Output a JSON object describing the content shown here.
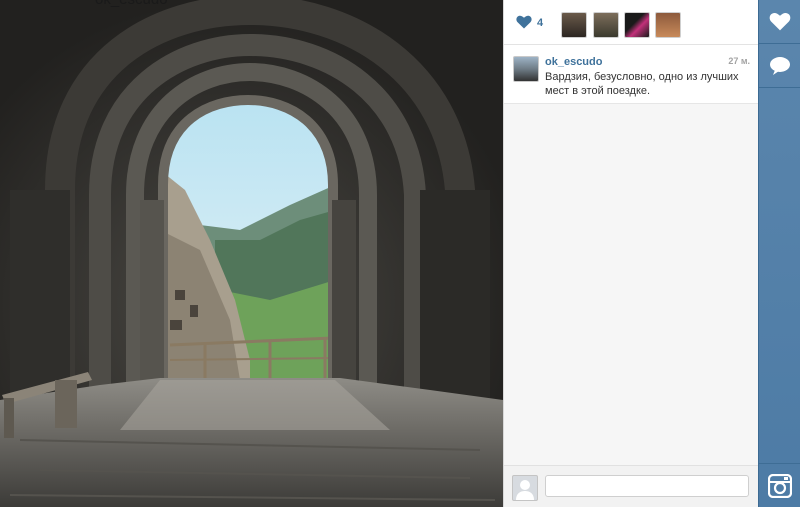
{
  "photo": {
    "top_text": "ok_escudo"
  },
  "likes": {
    "count": "4",
    "heart_icon": "heart-icon",
    "likers": [
      "liker-avatar-1",
      "liker-avatar-2",
      "liker-avatar-3",
      "liker-avatar-4"
    ]
  },
  "comment": {
    "username": "ok_escudo",
    "time": "27 м.",
    "text": "Вардзия, безусловно, одно из лучших мест в этой поездке."
  },
  "comment_box": {
    "placeholder": ""
  },
  "actions": {
    "like_icon": "heart-icon",
    "comment_icon": "speech-bubble-icon",
    "instagram_icon": "instagram-camera-icon"
  },
  "colors": {
    "link": "#3f729b",
    "action_bar": "#527ea8"
  }
}
